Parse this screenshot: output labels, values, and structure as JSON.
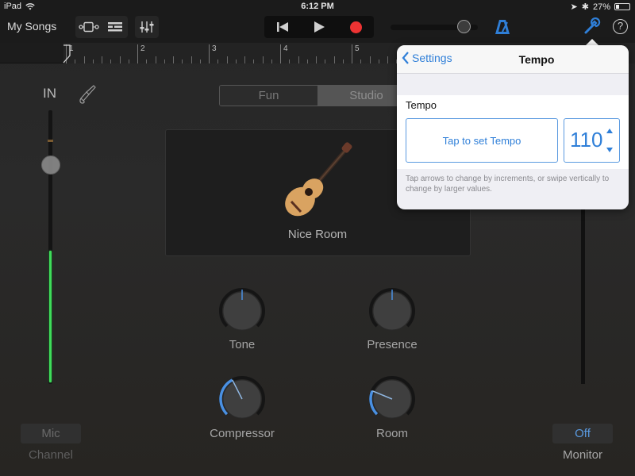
{
  "status_bar": {
    "device": "iPad",
    "time": "6:12 PM",
    "battery": "27%",
    "battery_level": 0.27
  },
  "toolbar": {
    "my_songs": "My Songs",
    "view_buttons": [
      "tracks-view-icon",
      "browser-view-icon",
      "mixer-icon"
    ],
    "transport": [
      "go-to-beginning-icon",
      "play-icon",
      "record-icon"
    ],
    "master_volume_level": 0.92,
    "colors": {
      "accent": "#2f7fd8",
      "record": "#ee3333"
    }
  },
  "ruler": {
    "bars": [
      "1",
      "2",
      "3",
      "4",
      "5"
    ],
    "playhead_bar": 1
  },
  "input": {
    "label": "IN",
    "level_fraction": 0.48,
    "gain_fraction": 0.8,
    "level_color": "#3fdc5a"
  },
  "segmented": {
    "options": [
      "Fun",
      "Studio"
    ],
    "selected": "Studio"
  },
  "instrument": {
    "name": "Nice Room",
    "icon": "acoustic-guitar-icon"
  },
  "knobs": [
    {
      "label": "Tone",
      "value": 0.5
    },
    {
      "label": "Presence",
      "value": 0.5
    },
    {
      "label": "Compressor",
      "value": 0.4
    },
    {
      "label": "Room",
      "value": 0.25
    }
  ],
  "channel": {
    "button": "Mic",
    "caption": "Channel"
  },
  "monitor": {
    "button": "Off",
    "caption": "Monitor"
  },
  "popover": {
    "back_label": "Settings",
    "title": "Tempo",
    "section_label": "Tempo",
    "tap_button": "Tap to set Tempo",
    "tempo_value": "110",
    "hint": "Tap arrows to change by increments, or swipe vertically to change by larger values."
  }
}
